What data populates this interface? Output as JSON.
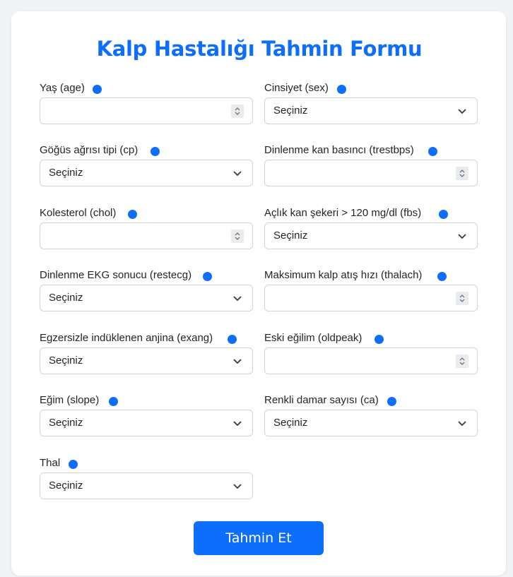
{
  "form": {
    "title": "Kalp Hastalığı Tahmin Formu",
    "submit_label": "Tahmin Et",
    "fields": [
      {
        "id": "age",
        "label": "Yaş (age)",
        "type": "number",
        "value": ""
      },
      {
        "id": "sex",
        "label": "Cinsiyet (sex)",
        "type": "select",
        "value": "Seçiniz"
      },
      {
        "id": "cp",
        "label": "Göğüs ağrısı tipi (cp)",
        "type": "select",
        "value": "Seçiniz"
      },
      {
        "id": "trestbps",
        "label": "Dinlenme kan basıncı (trestbps)",
        "type": "number",
        "value": ""
      },
      {
        "id": "chol",
        "label": "Kolesterol (chol)",
        "type": "number",
        "value": ""
      },
      {
        "id": "fbs",
        "label": "Açlık kan şekeri > 120 mg/dl (fbs)",
        "type": "select",
        "value": "Seçiniz"
      },
      {
        "id": "restecg",
        "label": "Dinlenme EKG sonucu (restecg)",
        "type": "select",
        "value": "Seçiniz"
      },
      {
        "id": "thalach",
        "label": "Maksimum kalp atış hızı (thalach)",
        "type": "number",
        "value": ""
      },
      {
        "id": "exang",
        "label": "Egzersizle indüklenen anjina (exang)",
        "type": "select",
        "value": "Seçiniz"
      },
      {
        "id": "oldpeak",
        "label": "Eski eğilim (oldpeak)",
        "type": "number",
        "value": ""
      },
      {
        "id": "slope",
        "label": "Eğim (slope)",
        "type": "select",
        "value": "Seçiniz"
      },
      {
        "id": "ca",
        "label": "Renkli damar sayısı (ca)",
        "type": "select",
        "value": "Seçiniz"
      },
      {
        "id": "thal",
        "label": "Thal",
        "type": "select",
        "value": "Seçiniz"
      }
    ]
  },
  "colors": {
    "accent": "#0d6efd",
    "border": "#ced4da",
    "background": "#f1f3f5",
    "card": "#ffffff"
  },
  "icons": {
    "info": "info-dot-icon",
    "select": "chevron-down-icon",
    "number": "spinner-arrows-icon"
  }
}
